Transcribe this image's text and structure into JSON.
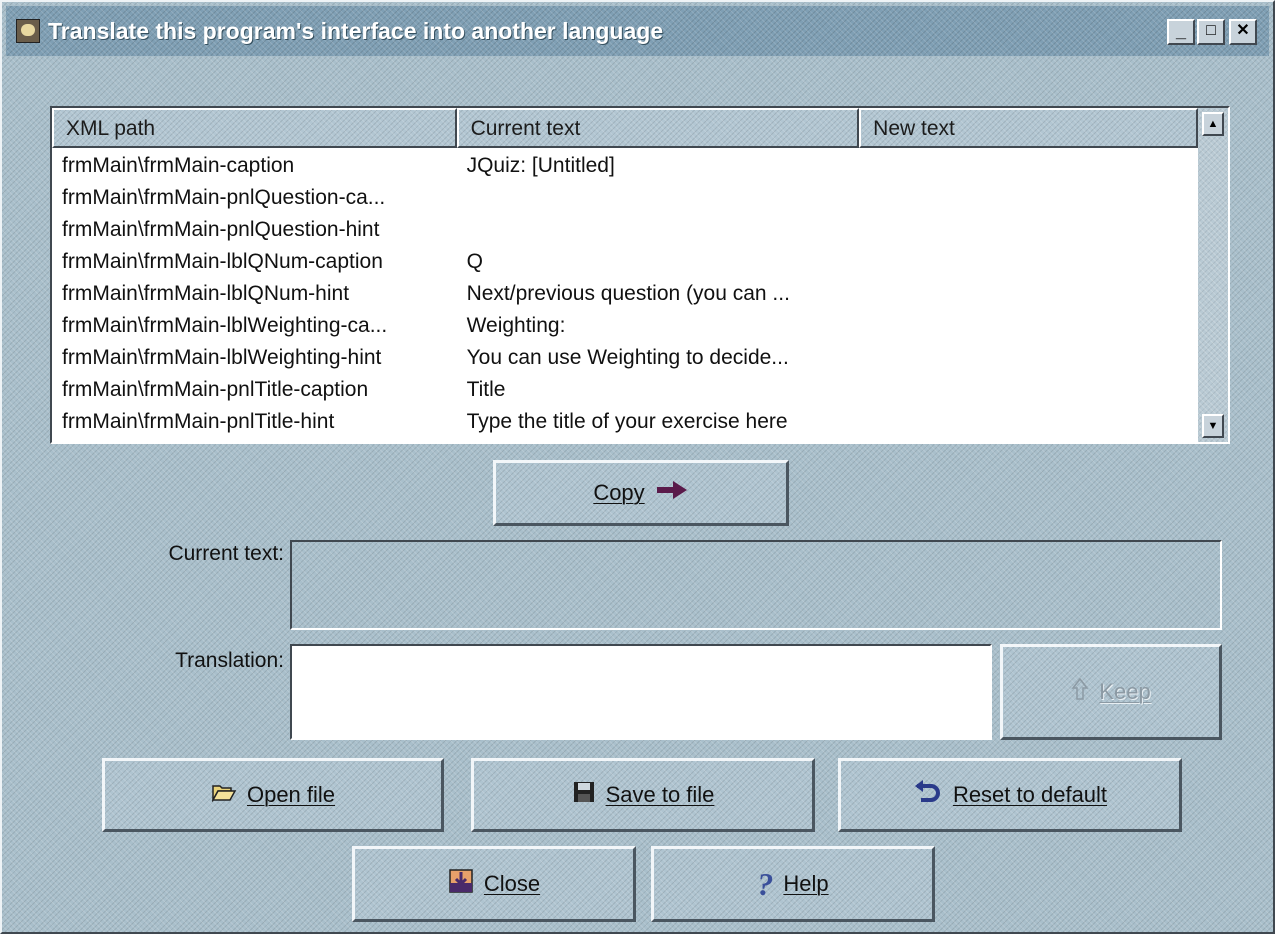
{
  "window": {
    "title": "Translate this program's  interface into another language",
    "minimize_glyph": "_",
    "maximize_glyph": "□",
    "close_glyph": "✕"
  },
  "table": {
    "columns": [
      "XML path",
      "Current text",
      "New text"
    ],
    "rows": [
      [
        "frmMain\\frmMain-caption",
        "JQuiz: [Untitled]",
        ""
      ],
      [
        "frmMain\\frmMain-pnlQuestion-ca...",
        "",
        ""
      ],
      [
        "frmMain\\frmMain-pnlQuestion-hint",
        "",
        ""
      ],
      [
        "frmMain\\frmMain-lblQNum-caption",
        "Q",
        ""
      ],
      [
        "frmMain\\frmMain-lblQNum-hint",
        "Next/previous question (you can ...",
        ""
      ],
      [
        "frmMain\\frmMain-lblWeighting-ca...",
        "Weighting:",
        ""
      ],
      [
        "frmMain\\frmMain-lblWeighting-hint",
        "You can use Weighting to decide...",
        ""
      ],
      [
        "frmMain\\frmMain-pnlTitle-caption",
        "Title",
        ""
      ],
      [
        "frmMain\\frmMain-pnlTitle-hint",
        "Type the title of your exercise here",
        ""
      ]
    ],
    "scroll_up_glyph": "▲",
    "scroll_down_glyph": "▼"
  },
  "copy_button": {
    "label": "Copy",
    "icon": "arrow-right-icon"
  },
  "current_text": {
    "label": "Current text:",
    "value": ""
  },
  "translation": {
    "label": "Translation:",
    "value": ""
  },
  "keep_button": {
    "label": "Keep",
    "icon": "arrow-up-icon",
    "enabled": false
  },
  "buttons": {
    "open": {
      "label": "Open file",
      "icon": "folder-open-icon"
    },
    "save": {
      "label": "Save to file",
      "icon": "floppy-disk-icon"
    },
    "reset": {
      "label": "Reset to default",
      "icon": "undo-arrow-icon"
    },
    "close": {
      "label": "Close",
      "icon": "exit-icon"
    },
    "help": {
      "label": "Help",
      "icon": "question-mark-icon"
    }
  },
  "colors": {
    "window_bg": "#a9bfcb",
    "titlebar_bg": "#7f9fb4",
    "accent_arrow": "#5a1a4a",
    "save_icon": "#222222",
    "reset_icon": "#2a3a8a"
  }
}
